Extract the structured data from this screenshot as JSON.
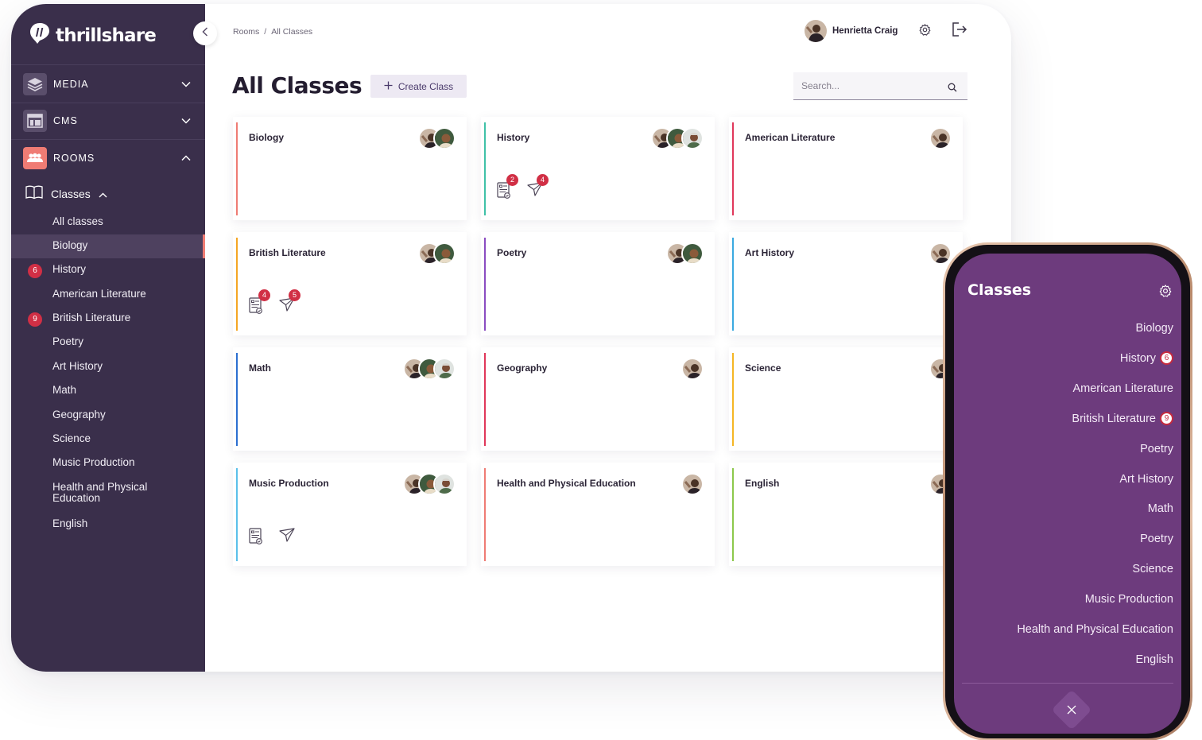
{
  "app": {
    "name": "thrillshare",
    "colors": {
      "sidebar": "#3a2f4b",
      "accent": "#ef7c74",
      "badge": "#d12f45",
      "phone_bg": "#6d3b7d"
    }
  },
  "sidebar": {
    "sections": [
      {
        "label": "MEDIA",
        "icon": "layers-icon",
        "state": "collapsed"
      },
      {
        "label": "CMS",
        "icon": "layout-icon",
        "state": "collapsed"
      },
      {
        "label": "ROOMS",
        "icon": "people-icon",
        "state": "expanded"
      }
    ],
    "classes_label": "Classes",
    "items": [
      {
        "label": "All classes",
        "badge": ""
      },
      {
        "label": "Biology",
        "badge": "",
        "active": true
      },
      {
        "label": "History",
        "badge": "6"
      },
      {
        "label": "American Literature",
        "badge": ""
      },
      {
        "label": "British Literature",
        "badge": "9"
      },
      {
        "label": "Poetry",
        "badge": ""
      },
      {
        "label": "Art History",
        "badge": ""
      },
      {
        "label": "Math",
        "badge": ""
      },
      {
        "label": "Geography",
        "badge": ""
      },
      {
        "label": "Science",
        "badge": ""
      },
      {
        "label": "Music Production",
        "badge": ""
      },
      {
        "label": "Health and Physical Education",
        "badge": ""
      },
      {
        "label": "English",
        "badge": ""
      }
    ]
  },
  "header": {
    "breadcrumb": [
      "Rooms",
      "/",
      "All Classes"
    ],
    "user_name": "Henrietta Craig"
  },
  "main": {
    "title": "All Classes",
    "create_label": "Create Class",
    "search_placeholder": "Search..."
  },
  "cards": [
    {
      "name": "Biology",
      "color": "#ef7c74",
      "avatars": 2,
      "posts": null,
      "messages": null
    },
    {
      "name": "History",
      "color": "#3fc1a8",
      "avatars": 3,
      "posts": "2",
      "messages": "4"
    },
    {
      "name": "American Literature",
      "color": "#e0375a",
      "avatars": 1,
      "posts": null,
      "messages": null
    },
    {
      "name": "British Literature",
      "color": "#f5a623",
      "avatars": 2,
      "posts": "4",
      "messages": "5"
    },
    {
      "name": "Poetry",
      "color": "#8a4cc1",
      "avatars": 2,
      "posts": null,
      "messages": null
    },
    {
      "name": "Art History",
      "color": "#3aa9e0",
      "avatars": 1,
      "posts": null,
      "messages": null
    },
    {
      "name": "Math",
      "color": "#2c6fd1",
      "avatars": 3,
      "posts": null,
      "messages": null
    },
    {
      "name": "Geography",
      "color": "#e0375a",
      "avatars": 1,
      "posts": null,
      "messages": null
    },
    {
      "name": "Science",
      "color": "#f5b623",
      "avatars": 1,
      "posts": null,
      "messages": null
    },
    {
      "name": "Music Production",
      "color": "#5bc0ea",
      "avatars": 3,
      "posts": "",
      "messages": ""
    },
    {
      "name": "Health and Physical Education",
      "color": "#ef7c74",
      "avatars": 1,
      "posts": null,
      "messages": null
    },
    {
      "name": "English",
      "color": "#8cc84b",
      "avatars": 1,
      "posts": null,
      "messages": null
    }
  ],
  "phone": {
    "title": "Classes",
    "items": [
      {
        "label": "Biology",
        "badge": ""
      },
      {
        "label": "History",
        "badge": "6"
      },
      {
        "label": "American Literature",
        "badge": ""
      },
      {
        "label": "British Literature",
        "badge": "9"
      },
      {
        "label": "Poetry",
        "badge": ""
      },
      {
        "label": "Art History",
        "badge": ""
      },
      {
        "label": "Math",
        "badge": ""
      },
      {
        "label": "Poetry",
        "badge": ""
      },
      {
        "label": "Science",
        "badge": ""
      },
      {
        "label": "Music Production",
        "badge": ""
      },
      {
        "label": "Health and Physical Education",
        "badge": ""
      },
      {
        "label": "English",
        "badge": ""
      }
    ]
  }
}
